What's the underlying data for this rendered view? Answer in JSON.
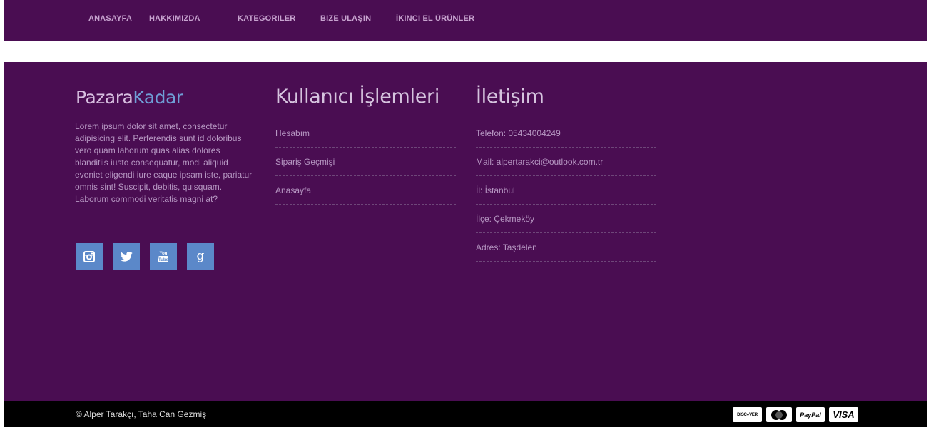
{
  "nav": {
    "items": [
      {
        "label": "ANASAYFA"
      },
      {
        "label": "HAKKIMIZDA"
      },
      {
        "label": "KATEGORILER"
      },
      {
        "label": "BIZE ULAŞIN"
      },
      {
        "label": "İKINCI EL ÜRÜNLER"
      }
    ]
  },
  "brand": {
    "part1": "Pazara",
    "part2": "Kadar",
    "description": "Lorem ipsum dolor sit amet, consectetur adipisicing elit. Perferendis sunt id doloribus vero quam laborum quas alias dolores blanditiis iusto consequatur, modi aliquid eveniet eligendi iure eaque ipsam iste, pariatur omnis sint! Suscipit, debitis, quisquam. Laborum commodi veritatis magni at?"
  },
  "social": [
    {
      "icon": "instagram-icon"
    },
    {
      "icon": "twitter-icon"
    },
    {
      "icon": "youtube-icon"
    },
    {
      "icon": "google-icon"
    }
  ],
  "user_ops": {
    "title": "Kullanıcı İşlemleri",
    "items": [
      {
        "label": "Hesabım"
      },
      {
        "label": "Sipariş Geçmişi"
      },
      {
        "label": "Anasayfa"
      }
    ]
  },
  "contact": {
    "title": "İletişim",
    "items": [
      {
        "text": "Telefon: 05434004249"
      },
      {
        "text": "Mail: alpertarakci@outlook.com.tr"
      },
      {
        "text": "İl: İstanbul"
      },
      {
        "text": "İlçe: Çekmeköy"
      },
      {
        "text": "Adres: Taşdelen"
      }
    ]
  },
  "bottom": {
    "copyright": "© Alper Tarakçı, Taha Can Gezmiş",
    "cards": {
      "discover": "DISC●VER",
      "mastercard": "MasterCard",
      "paypal": "PayPal",
      "visa": "VISA"
    }
  },
  "colors": {
    "primary": "#4a0d52",
    "accent": "#5b88c9",
    "brand_accent": "#6f9ed6",
    "bottom_bar": "#000000"
  }
}
